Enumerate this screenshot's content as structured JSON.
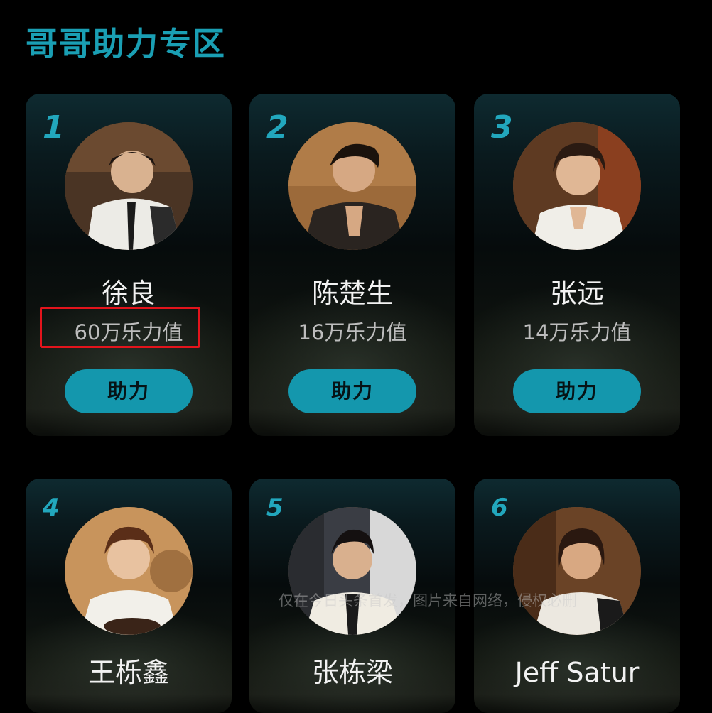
{
  "section_title": "哥哥助力专区",
  "boost_label": "助力",
  "cards": [
    {
      "rank": "1",
      "name": "徐良",
      "score": "60万乐力值",
      "has_button": true
    },
    {
      "rank": "2",
      "name": "陈楚生",
      "score": "16万乐力值",
      "has_button": true
    },
    {
      "rank": "3",
      "name": "张远",
      "score": "14万乐力值",
      "has_button": true
    },
    {
      "rank": "4",
      "name": "王栎鑫",
      "score": "",
      "has_button": false
    },
    {
      "rank": "5",
      "name": "张栋梁",
      "score": "",
      "has_button": false
    },
    {
      "rank": "6",
      "name": "Jeff Satur",
      "score": "",
      "has_button": false
    }
  ],
  "watermark": "仅在今日头条首发，图片来自网络，侵权必删",
  "colors": {
    "accent": "#1a9fb4",
    "button": "#1497ad",
    "highlight": "#e3141c"
  }
}
